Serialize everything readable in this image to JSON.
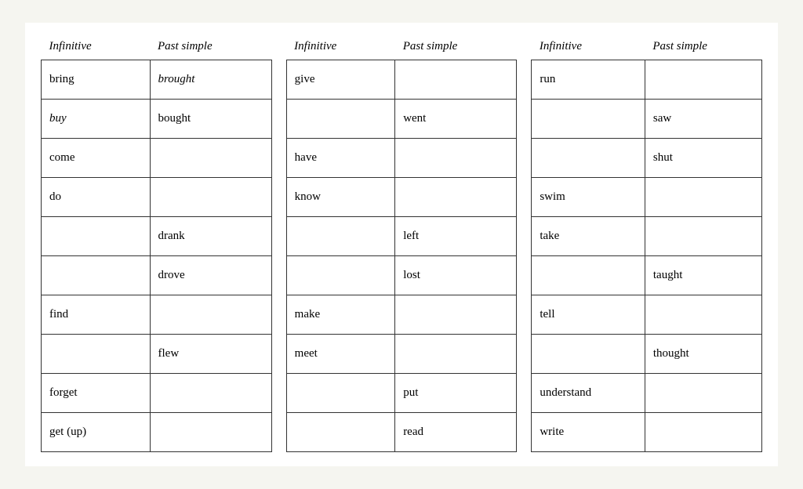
{
  "tables": [
    {
      "id": "table1",
      "headers": [
        "Infinitive",
        "Past simple"
      ],
      "rows": [
        {
          "infinitive": "bring",
          "infinitive_italic": false,
          "past_simple": "brought",
          "past_italic": true
        },
        {
          "infinitive": "buy",
          "infinitive_italic": true,
          "past_simple": "bought",
          "past_italic": false
        },
        {
          "infinitive": "come",
          "infinitive_italic": false,
          "past_simple": "",
          "past_italic": false
        },
        {
          "infinitive": "do",
          "infinitive_italic": false,
          "past_simple": "",
          "past_italic": false
        },
        {
          "infinitive": "",
          "infinitive_italic": false,
          "past_simple": "drank",
          "past_italic": false
        },
        {
          "infinitive": "",
          "infinitive_italic": false,
          "past_simple": "drove",
          "past_italic": false
        },
        {
          "infinitive": "find",
          "infinitive_italic": false,
          "past_simple": "",
          "past_italic": false
        },
        {
          "infinitive": "",
          "infinitive_italic": false,
          "past_simple": "flew",
          "past_italic": false
        },
        {
          "infinitive": "forget",
          "infinitive_italic": false,
          "past_simple": "",
          "past_italic": false
        },
        {
          "infinitive": "get (up)",
          "infinitive_italic": false,
          "past_simple": "",
          "past_italic": false
        }
      ]
    },
    {
      "id": "table2",
      "headers": [
        "Infinitive",
        "Past simple"
      ],
      "rows": [
        {
          "infinitive": "give",
          "infinitive_italic": false,
          "past_simple": "",
          "past_italic": false
        },
        {
          "infinitive": "",
          "infinitive_italic": false,
          "past_simple": "went",
          "past_italic": false
        },
        {
          "infinitive": "have",
          "infinitive_italic": false,
          "past_simple": "",
          "past_italic": false
        },
        {
          "infinitive": "know",
          "infinitive_italic": false,
          "past_simple": "",
          "past_italic": false
        },
        {
          "infinitive": "",
          "infinitive_italic": false,
          "past_simple": "left",
          "past_italic": false
        },
        {
          "infinitive": "",
          "infinitive_italic": false,
          "past_simple": "lost",
          "past_italic": false
        },
        {
          "infinitive": "make",
          "infinitive_italic": false,
          "past_simple": "",
          "past_italic": false
        },
        {
          "infinitive": "meet",
          "infinitive_italic": false,
          "past_simple": "",
          "past_italic": false
        },
        {
          "infinitive": "",
          "infinitive_italic": false,
          "past_simple": "put",
          "past_italic": false
        },
        {
          "infinitive": "",
          "infinitive_italic": false,
          "past_simple": "read",
          "past_italic": false
        }
      ]
    },
    {
      "id": "table3",
      "headers": [
        "Infinitive",
        "Past simple"
      ],
      "rows": [
        {
          "infinitive": "run",
          "infinitive_italic": false,
          "past_simple": "",
          "past_italic": false
        },
        {
          "infinitive": "",
          "infinitive_italic": false,
          "past_simple": "saw",
          "past_italic": false
        },
        {
          "infinitive": "",
          "infinitive_italic": false,
          "past_simple": "shut",
          "past_italic": false
        },
        {
          "infinitive": "swim",
          "infinitive_italic": false,
          "past_simple": "",
          "past_italic": false
        },
        {
          "infinitive": "take",
          "infinitive_italic": false,
          "past_simple": "",
          "past_italic": false
        },
        {
          "infinitive": "",
          "infinitive_italic": false,
          "past_simple": "taught",
          "past_italic": false
        },
        {
          "infinitive": "tell",
          "infinitive_italic": false,
          "past_simple": "",
          "past_italic": false
        },
        {
          "infinitive": "",
          "infinitive_italic": false,
          "past_simple": "thought",
          "past_italic": false
        },
        {
          "infinitive": "understand",
          "infinitive_italic": false,
          "past_simple": "",
          "past_italic": false
        },
        {
          "infinitive": "write",
          "infinitive_italic": false,
          "past_simple": "",
          "past_italic": false
        }
      ]
    }
  ]
}
